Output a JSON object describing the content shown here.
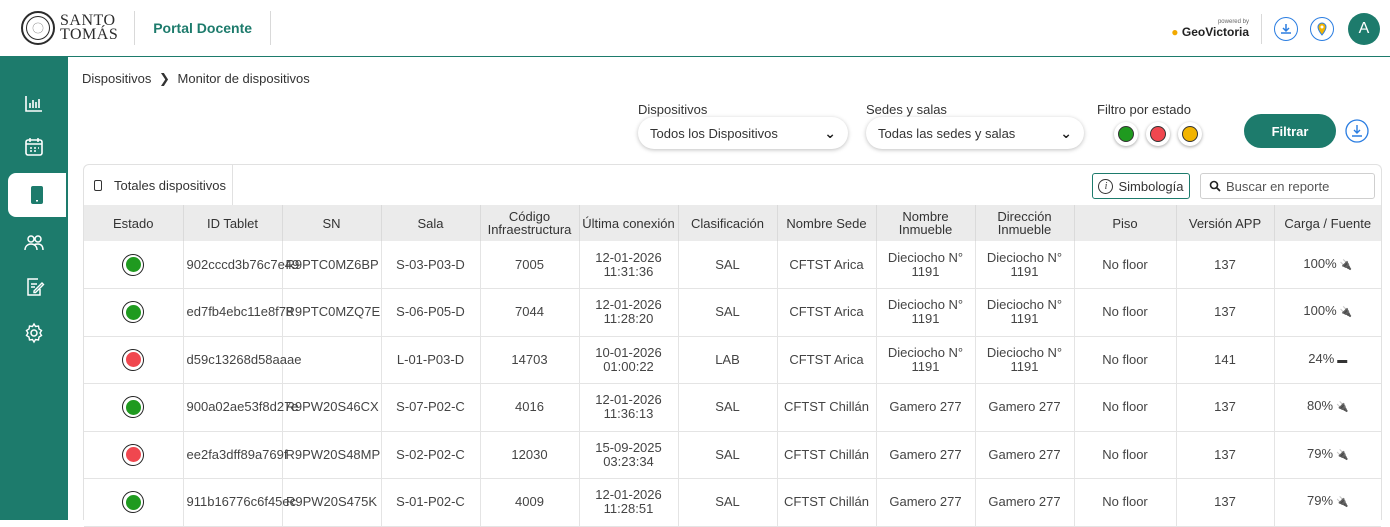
{
  "header": {
    "logo_text_line1": "SANTO",
    "logo_text_line2": "TOMÁS",
    "portal_title": "Portal Docente",
    "powered_by": "powered by",
    "brand": "GeoVictoria",
    "avatar_letter": "A"
  },
  "sidebar": {
    "items": [
      {
        "icon": "bar-chart-icon",
        "active": false
      },
      {
        "icon": "calendar-icon",
        "active": false
      },
      {
        "icon": "tablet-icon",
        "active": true
      },
      {
        "icon": "users-icon",
        "active": false
      },
      {
        "icon": "edit-document-icon",
        "active": false
      },
      {
        "icon": "settings-icon",
        "active": false
      }
    ]
  },
  "breadcrumb": {
    "root": "Dispositivos",
    "separator": "❯",
    "current": "Monitor de dispositivos"
  },
  "filters": {
    "devices_label": "Dispositivos",
    "devices_value": "Todos los Dispositivos",
    "sedes_label": "Sedes y salas",
    "sedes_value": "Todas las sedes y salas",
    "estado_label": "Filtro por estado",
    "estado_colors": [
      "#1f9a1f",
      "#f0474f",
      "#f2b400"
    ],
    "filter_button": "Filtrar"
  },
  "table": {
    "tab_label": "Totales dispositivos",
    "symbology_button": "Simbología",
    "search_placeholder": "Buscar en reporte",
    "columns": [
      "Estado",
      "ID Tablet",
      "SN",
      "Sala",
      "Código Infraestructura",
      "Última conexión",
      "Clasificación",
      "Nombre Sede",
      "Nombre Inmueble",
      "Dirección Inmueble",
      "Piso",
      "Versión APP",
      "Carga / Fuente"
    ],
    "rows": [
      {
        "status": "#1f9a1f",
        "id": "902cccd3b76c7e49",
        "sn": "R9PTC0MZ6BP",
        "sala": "S-03-P03-D",
        "codigo": "7005",
        "conexion": "12-01-2026 11:31:36",
        "clasif": "SAL",
        "sede": "CFTST Arica",
        "inmueble": "Dieciocho N° 1191",
        "direccion": "Dieciocho N° 1191",
        "piso": "No floor",
        "version": "137",
        "carga": "100%",
        "fuente": "🔌"
      },
      {
        "status": "#1f9a1f",
        "id": "ed7fb4ebc11e8f78",
        "sn": "R9PTC0MZQ7E",
        "sala": "S-06-P05-D",
        "codigo": "7044",
        "conexion": "12-01-2026 11:28:20",
        "clasif": "SAL",
        "sede": "CFTST Arica",
        "inmueble": "Dieciocho N° 1191",
        "direccion": "Dieciocho N° 1191",
        "piso": "No floor",
        "version": "137",
        "carga": "100%",
        "fuente": "🔌"
      },
      {
        "status": "#f0474f",
        "id": "d59c13268d58aaae",
        "sn": "",
        "sala": "L-01-P03-D",
        "codigo": "14703",
        "conexion": "10-01-2026 01:00:22",
        "clasif": "LAB",
        "sede": "CFTST Arica",
        "inmueble": "Dieciocho N° 1191",
        "direccion": "Dieciocho N° 1191",
        "piso": "No floor",
        "version": "141",
        "carga": "24%",
        "fuente": "▬"
      },
      {
        "status": "#1f9a1f",
        "id": "900a02ae53f8d27e",
        "sn": "R9PW20S46CX",
        "sala": "S-07-P02-C",
        "codigo": "4016",
        "conexion": "12-01-2026 11:36:13",
        "clasif": "SAL",
        "sede": "CFTST Chillán",
        "inmueble": "Gamero 277",
        "direccion": "Gamero 277",
        "piso": "No floor",
        "version": "137",
        "carga": "80%",
        "fuente": "🔌"
      },
      {
        "status": "#f0474f",
        "id": "ee2fa3dff89a769f",
        "sn": "R9PW20S48MP",
        "sala": "S-02-P02-C",
        "codigo": "12030",
        "conexion": "15-09-2025 03:23:34",
        "clasif": "SAL",
        "sede": "CFTST Chillán",
        "inmueble": "Gamero 277",
        "direccion": "Gamero 277",
        "piso": "No floor",
        "version": "137",
        "carga": "79%",
        "fuente": "🔌"
      },
      {
        "status": "#1f9a1f",
        "id": "911b16776c6f45ec",
        "sn": "R9PW20S475K",
        "sala": "S-01-P02-C",
        "codigo": "4009",
        "conexion": "12-01-2026 11:28:51",
        "clasif": "SAL",
        "sede": "CFTST Chillán",
        "inmueble": "Gamero 277",
        "direccion": "Gamero 277",
        "piso": "No floor",
        "version": "137",
        "carga": "79%",
        "fuente": "🔌"
      }
    ]
  }
}
